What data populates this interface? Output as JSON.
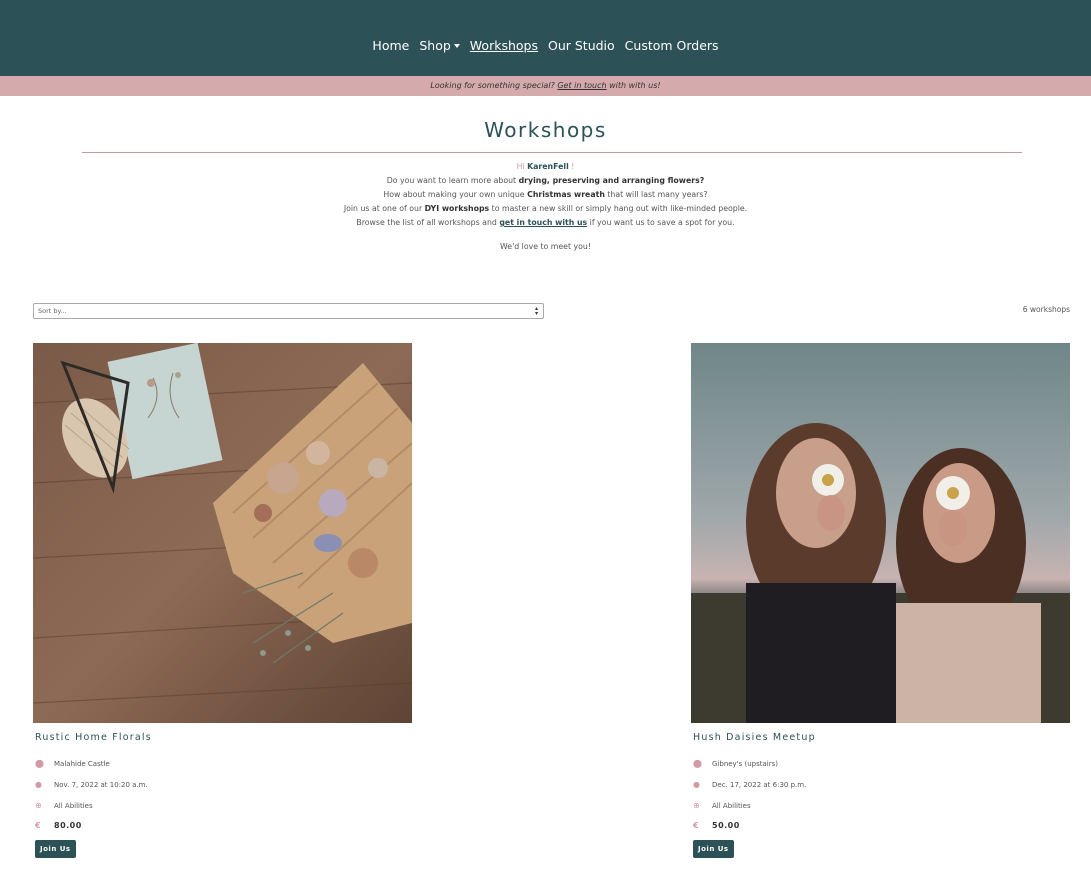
{
  "nav": {
    "items": [
      {
        "label": "Home"
      },
      {
        "label": "Shop"
      },
      {
        "label": "Workshops"
      },
      {
        "label": "Our Studio"
      },
      {
        "label": "Custom Orders"
      }
    ]
  },
  "banner": {
    "text_before": "Looking for something special?",
    "link": "Get in touch",
    "text_after": "with with us!"
  },
  "page": {
    "title": "Workshops"
  },
  "intro": {
    "hi": "Hi",
    "username": "KarenFell",
    "exclaim": "!",
    "line2_a": "Do you want to learn more about",
    "line2_b": "drying, preserving and arranging flowers?",
    "line3_a": "How about making your own unique",
    "line3_b": "Christmas wreath",
    "line3_c": "that will last many years?",
    "line4_a": "Join us at one of our",
    "line4_b": "DYI workshops",
    "line4_c": "to master a new skill or simply hang out with like-minded people.",
    "line5_a": "Browse the list of all workshops and",
    "line5_link": "get in touch with us",
    "line5_c": "if you want us to save a spot for you.",
    "closing": "We'd love to meet you!"
  },
  "sort": {
    "value": "Sort by..."
  },
  "count_text": "6 workshops",
  "workshops": [
    {
      "title": "Rustic Home Florals",
      "location": "Malahide Castle",
      "datetime": "Nov. 7, 2022 at 10:20 a.m.",
      "level": "All Abilities",
      "currency": "€",
      "price": "80.00",
      "button": "Join Us"
    },
    {
      "title": "Hush Daisies Meetup",
      "location": "Gibney's (upstairs)",
      "datetime": "Dec. 17, 2022 at 6:30 p.m.",
      "level": "All Abilities",
      "currency": "€",
      "price": "50.00",
      "button": "Join Us"
    }
  ],
  "icons": {
    "location": "map-pin-icon",
    "time": "clock-icon",
    "level": "globe-icon",
    "price": "euro-icon"
  },
  "colors": {
    "nav_bg": "#2c5157",
    "banner_bg": "#d5aaad",
    "accent": "#c99ca3",
    "button_bg": "#2c5157"
  }
}
